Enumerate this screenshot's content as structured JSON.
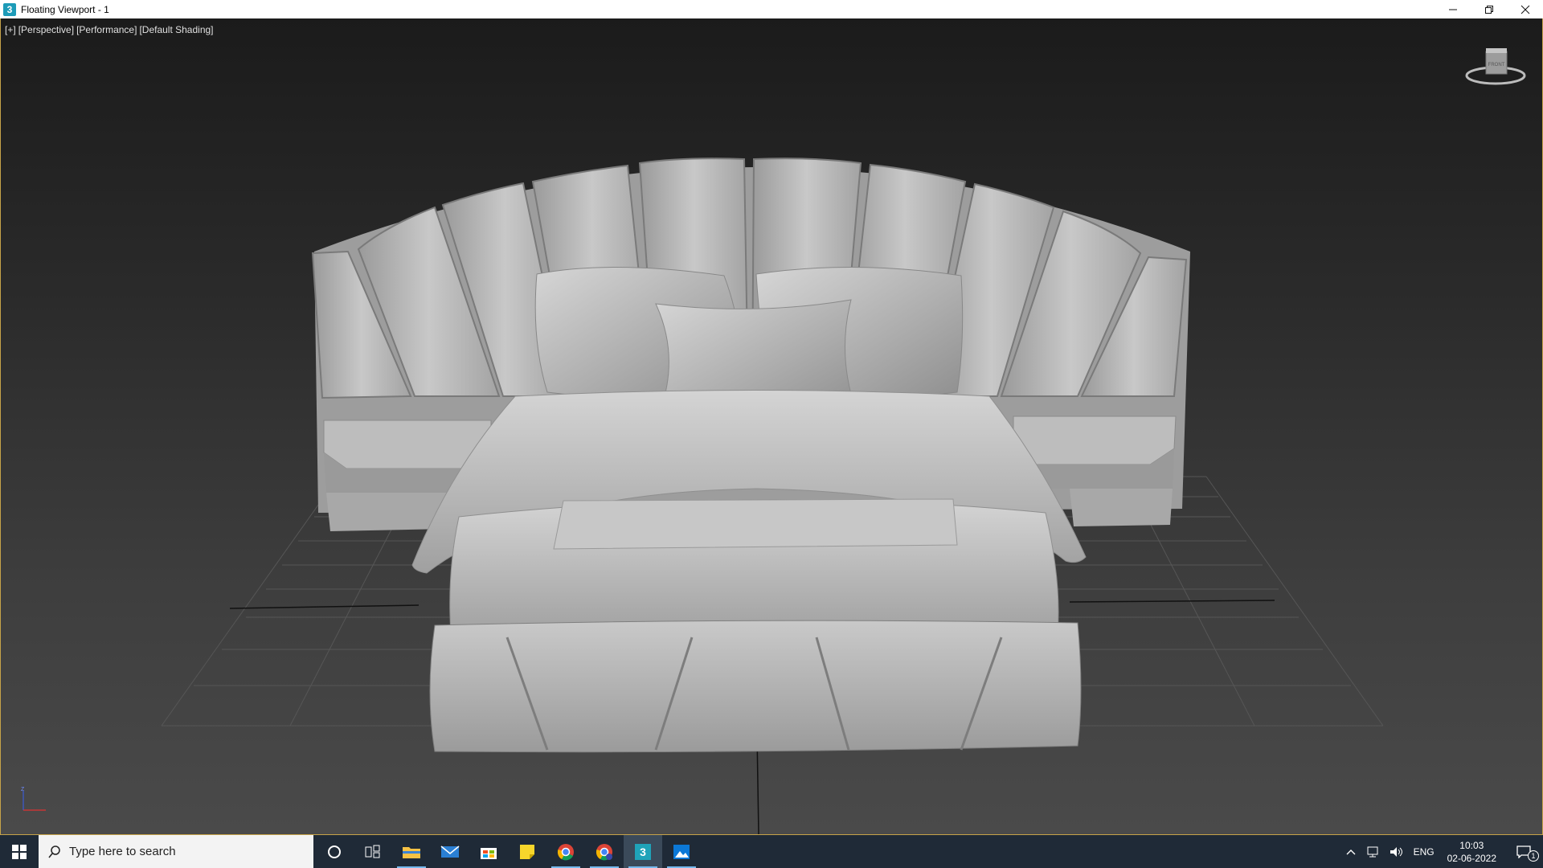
{
  "window": {
    "title": "Floating Viewport - 1",
    "app_icon_glyph": "3",
    "controls": [
      "minimize-icon",
      "restore-icon",
      "close-icon"
    ]
  },
  "viewport": {
    "labels": [
      "[+]",
      "[Perspective]",
      "[Performance]",
      "[Default Shading]"
    ],
    "viewcube_label": "FRONT",
    "axis_label": "Z",
    "border_color": "#c6a349",
    "model": "upholstered bed with fan headboard, pillows and nightstands"
  },
  "taskbar": {
    "search_placeholder": "Type here to search",
    "pinned": [
      {
        "name": "cortana-icon",
        "active": false
      },
      {
        "name": "task-view-icon",
        "active": false
      },
      {
        "name": "file-explorer-icon",
        "active": true
      },
      {
        "name": "mail-icon",
        "active": false
      },
      {
        "name": "microsoft-store-icon",
        "active": false
      },
      {
        "name": "sticky-notes-icon",
        "active": false
      },
      {
        "name": "chrome-icon",
        "active": true
      },
      {
        "name": "chrome-profile-icon",
        "active": true
      },
      {
        "name": "3dsmax-icon",
        "active": true
      },
      {
        "name": "photos-icon",
        "active": true
      }
    ],
    "tray": {
      "language": "ENG",
      "time": "10:03",
      "date": "02-06-2022",
      "notification_count": "1"
    },
    "colors": {
      "background": "#1f2a37",
      "active_indicator": "#76b9ed"
    }
  }
}
